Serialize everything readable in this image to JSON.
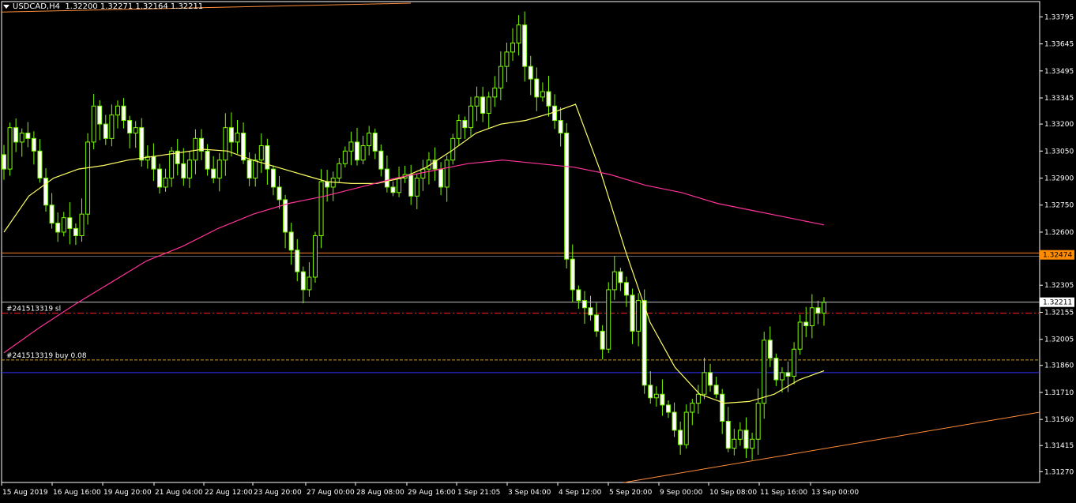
{
  "header": {
    "symbol": "USDCAD,H4",
    "prices": "1.32200 1.32271 1.32164 1.32211"
  },
  "colors": {
    "background": "#000000",
    "candle": "#7CFC00",
    "candle_body_up": "#000000",
    "candle_body_down": "#ffffff",
    "ma_fast": "#ffff66",
    "ma_slow": "#ff3399",
    "trendline": "#ff8c3a",
    "hline_orange": "#ff7f27",
    "sl_line": "#ff2020",
    "entry_line": "#d4a017",
    "blue_line": "#3333ff",
    "bid_line": "#c0c0c0",
    "badge_bg": "#ff8c00"
  },
  "chart_data": {
    "type": "candlestick",
    "symbol": "USDCAD",
    "timeframe": "H4",
    "y_ticks": [
      "1.33795",
      "1.33645",
      "1.33495",
      "1.33345",
      "1.33200",
      "1.33050",
      "1.32900",
      "1.32750",
      "1.32600",
      "1.32305",
      "1.32155",
      "1.32005",
      "1.31860",
      "1.31710",
      "1.31560",
      "1.31415",
      "1.31270"
    ],
    "ylim": [
      1.3121,
      1.3388
    ],
    "x_labels": [
      "15 Aug 2019",
      "16 Aug 16:00",
      "19 Aug 20:00",
      "21 Aug 04:00",
      "22 Aug 12:00",
      "23 Aug 20:00",
      "27 Aug 00:00",
      "28 Aug 08:00",
      "29 Aug 16:00",
      "1 Sep 21:05",
      "3 Sep 04:00",
      "4 Sep 12:00",
      "5 Sep 20:00",
      "9 Sep 00:00",
      "10 Sep 08:00",
      "11 Sep 16:00",
      "13 Sep 00:00"
    ],
    "current_price": "1.32211",
    "highlight_price": "1.32474",
    "orders": [
      {
        "label": "#241513319 sl",
        "price": 1.3215
      },
      {
        "label": "#241513319 buy 0.08",
        "price": 1.3189
      }
    ],
    "levels": {
      "resistance_1": 1.3248,
      "resistance_2": 1.3247,
      "blue_support": 1.3182
    },
    "closes": [
      1.3295,
      1.3318,
      1.331,
      1.3315,
      1.3312,
      1.3305,
      1.329,
      1.3275,
      1.3265,
      1.326,
      1.3268,
      1.3262,
      1.3258,
      1.327,
      1.331,
      1.333,
      1.332,
      1.3312,
      1.3325,
      1.333,
      1.3322,
      1.3315,
      1.3318,
      1.33,
      1.3302,
      1.3295,
      1.3285,
      1.329,
      1.3305,
      1.3298,
      1.329,
      1.33,
      1.3312,
      1.3305,
      1.3295,
      1.329,
      1.33,
      1.3318,
      1.331,
      1.3315,
      1.33,
      1.329,
      1.33,
      1.3308,
      1.3295,
      1.3285,
      1.3278,
      1.326,
      1.325,
      1.3238,
      1.3228,
      1.3235,
      1.3258,
      1.3288,
      1.3285,
      1.329,
      1.3298,
      1.3305,
      1.331,
      1.33,
      1.3308,
      1.3315,
      1.3305,
      1.3295,
      1.3285,
      1.3282,
      1.329,
      1.3292,
      1.328,
      1.329,
      1.3295,
      1.33,
      1.3295,
      1.3285,
      1.33,
      1.3312,
      1.3322,
      1.3318,
      1.333,
      1.3335,
      1.3326,
      1.3335,
      1.334,
      1.3352,
      1.336,
      1.3365,
      1.3375,
      1.3352,
      1.3345,
      1.3335,
      1.3338,
      1.333,
      1.3322,
      1.3315,
      1.3245,
      1.3228,
      1.3222,
      1.3218,
      1.3214,
      1.3205,
      1.3195,
      1.3228,
      1.3238,
      1.3232,
      1.3225,
      1.3205,
      1.3222,
      1.3175,
      1.3168,
      1.317,
      1.3164,
      1.316,
      1.315,
      1.3142,
      1.316,
      1.3165,
      1.317,
      1.3182,
      1.3175,
      1.317,
      1.3155,
      1.314,
      1.3145,
      1.315,
      1.314,
      1.3145,
      1.3165,
      1.32,
      1.319,
      1.3178,
      1.3182,
      1.318,
      1.3195,
      1.321,
      1.3208,
      1.3218,
      1.3215,
      1.3221
    ],
    "ma_fast": [
      1.326,
      1.328,
      1.329,
      1.3295,
      1.3297,
      1.33,
      1.3302,
      1.3304,
      1.3306,
      1.3305,
      1.33,
      1.3296,
      1.3292,
      1.3288,
      1.3287,
      1.3287,
      1.329,
      1.3296,
      1.3305,
      1.3315,
      1.332,
      1.3322,
      1.3326,
      1.3331,
      1.3294,
      1.325,
      1.321,
      1.3185,
      1.317,
      1.3165,
      1.3166,
      1.317,
      1.3178,
      1.3183
    ],
    "ma_slow": [
      1.3193,
      1.3207,
      1.322,
      1.3232,
      1.3244,
      1.3252,
      1.3262,
      1.327,
      1.3276,
      1.328,
      1.3285,
      1.329,
      1.3294,
      1.3298,
      1.33,
      1.3298,
      1.3296,
      1.3292,
      1.3286,
      1.3282,
      1.3276,
      1.3272,
      1.3268,
      1.3264
    ]
  }
}
